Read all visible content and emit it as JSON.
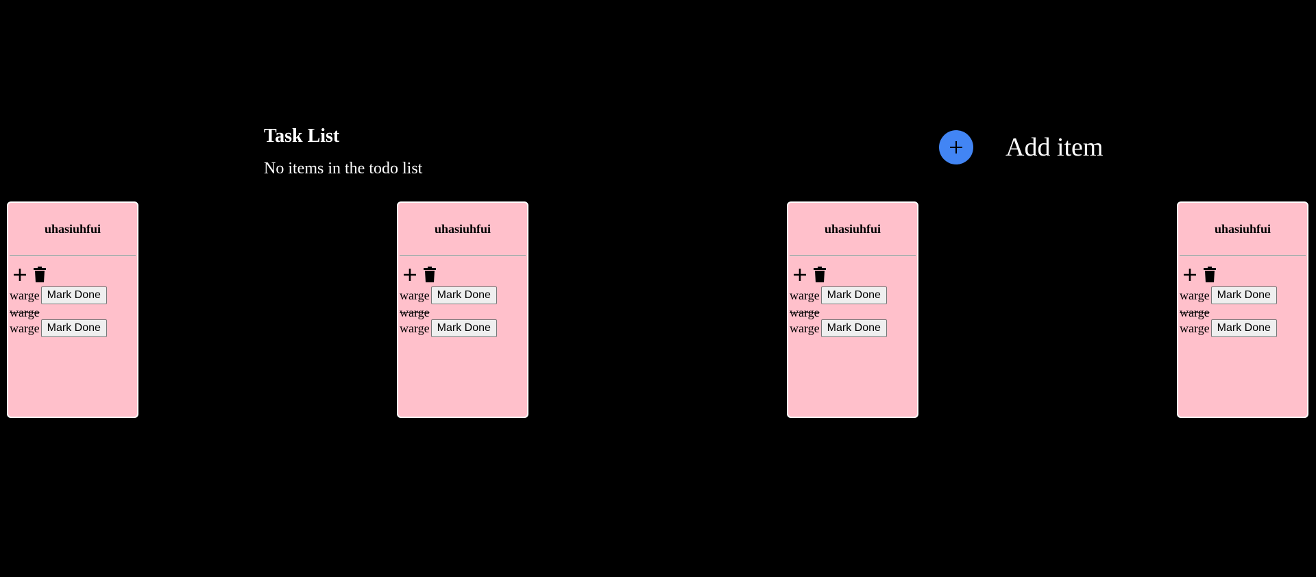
{
  "header": {
    "title": "Task List",
    "empty_message": "No items in the todo list"
  },
  "add_item": {
    "icon": "plus-icon",
    "label": "Add item",
    "accent_color": "#4285f4"
  },
  "colors": {
    "background": "#000000",
    "card_background": "#ffc0cb",
    "card_border": "#ffffff",
    "text_on_dark": "#ffffff"
  },
  "cards": [
    {
      "title": "uhasiuhfui",
      "action_icons": [
        "plus-icon",
        "trash-icon"
      ],
      "tasks": [
        {
          "text": "warge",
          "done": false,
          "button_label": "Mark Done"
        },
        {
          "text": "warge",
          "done": true
        },
        {
          "text": "warge",
          "done": false,
          "button_label": "Mark Done"
        }
      ]
    },
    {
      "title": "uhasiuhfui",
      "action_icons": [
        "plus-icon",
        "trash-icon"
      ],
      "tasks": [
        {
          "text": "warge",
          "done": false,
          "button_label": "Mark Done"
        },
        {
          "text": "warge",
          "done": true
        },
        {
          "text": "warge",
          "done": false,
          "button_label": "Mark Done"
        }
      ]
    },
    {
      "title": "uhasiuhfui",
      "action_icons": [
        "plus-icon",
        "trash-icon"
      ],
      "tasks": [
        {
          "text": "warge",
          "done": false,
          "button_label": "Mark Done"
        },
        {
          "text": "warge",
          "done": true
        },
        {
          "text": "warge",
          "done": false,
          "button_label": "Mark Done"
        }
      ]
    },
    {
      "title": "uhasiuhfui",
      "action_icons": [
        "plus-icon",
        "trash-icon"
      ],
      "tasks": [
        {
          "text": "warge",
          "done": false,
          "button_label": "Mark Done"
        },
        {
          "text": "warge",
          "done": true
        },
        {
          "text": "warge",
          "done": false,
          "button_label": "Mark Done"
        }
      ]
    }
  ]
}
